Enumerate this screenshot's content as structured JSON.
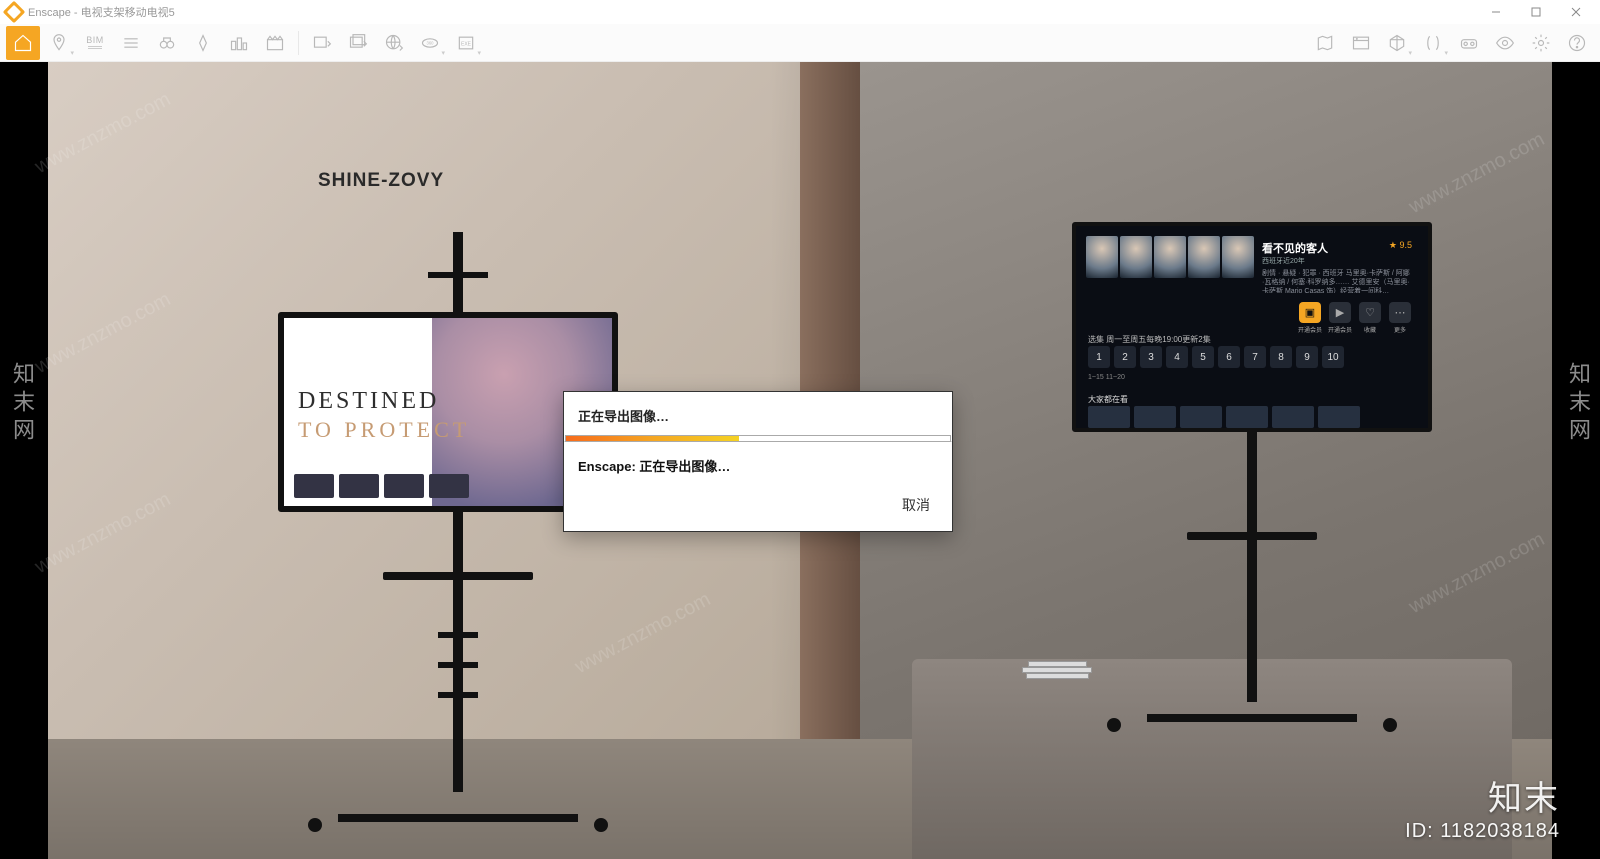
{
  "app": {
    "title": "Enscape - 电视支架移动电视5"
  },
  "toolbar": {
    "left": [
      "home",
      "pin",
      "bim",
      "menu",
      "binoculars",
      "compass",
      "city",
      "clapper",
      "sep",
      "export-img",
      "export-img2",
      "globe",
      "360",
      "exe",
      "chev"
    ],
    "right": [
      "map",
      "view",
      "cube",
      "chev2",
      "mirror",
      "chev3",
      "vr",
      "eye",
      "gear",
      "help"
    ]
  },
  "scene": {
    "brand": "SHINE-ZOVY",
    "tv1": {
      "line1": "DESTINED",
      "line2": "TO   PROTECT"
    },
    "tv2": {
      "movie_title": "看不见的客人",
      "subtitle": "西班牙近20年",
      "rating": "★ 9.5",
      "desc": "剧情 · 悬疑 · 犯罪 · 西班牙\n马里奥·卡萨斯 / 阿娜·瓦格纳 / 何塞·科罗纳多……\n艾德里安（马里奥·卡萨斯 Mario Casas 饰）经营着一间科…",
      "actions": [
        {
          "label": "开通会员",
          "primary": true,
          "icon": "▣"
        },
        {
          "label": "开通会员",
          "icon": "▶"
        },
        {
          "label": "收藏",
          "icon": "♡"
        },
        {
          "label": "更多",
          "icon": "⋯"
        }
      ],
      "selection_label": "选集  周一至周五每晚19:00更新2集",
      "episodes": [
        "1",
        "2",
        "3",
        "4",
        "5",
        "6",
        "7",
        "8",
        "9",
        "10"
      ],
      "ep_range": "1~15   11~20",
      "rec_label": "大家都在看"
    }
  },
  "dialog": {
    "line1": "正在导出图像…",
    "line2": "Enscape: 正在导出图像…",
    "cancel": "取消",
    "progress_pct": 45
  },
  "watermark": {
    "repeat": "www.znzmo.com",
    "side": "知末网",
    "brand": "知末",
    "id_label": "ID: 1182038184"
  }
}
